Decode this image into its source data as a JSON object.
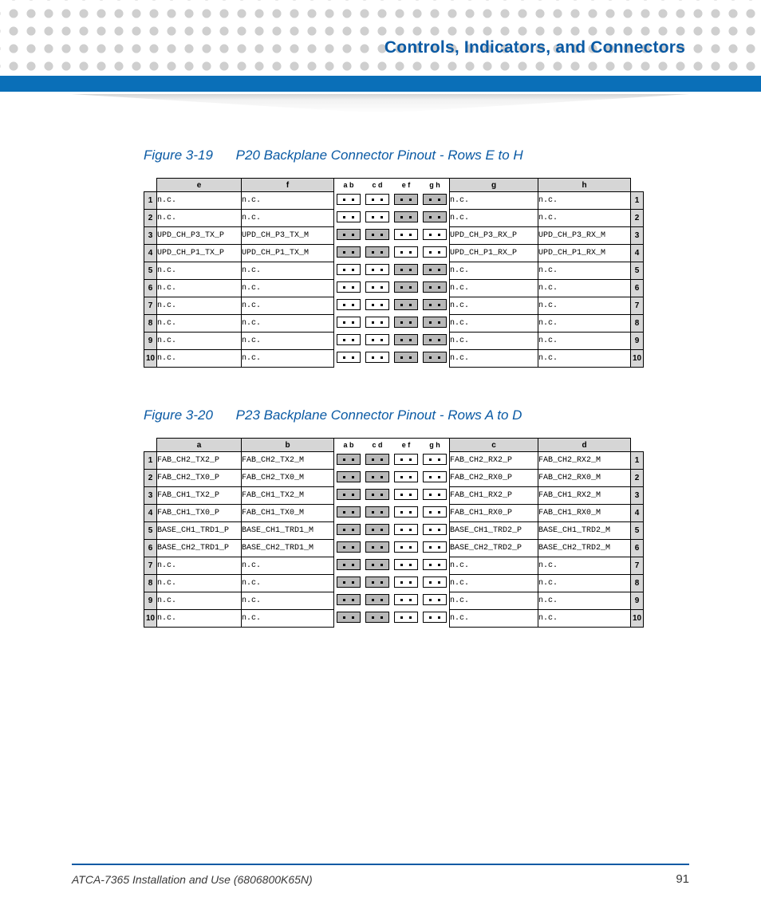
{
  "header": {
    "title": "Controls, Indicators, and Connectors"
  },
  "figures": [
    {
      "num": "Figure 3-19",
      "title": "P20 Backplane Connector Pinout - Rows E to H",
      "left_cols": [
        "e",
        "f"
      ],
      "right_cols": [
        "g",
        "h"
      ],
      "pair_headers": [
        "a b",
        "c d",
        "e f",
        "g h"
      ],
      "rows": [
        {
          "n": "1",
          "e": "n.c.",
          "f": "n.c.",
          "g": "n.c.",
          "h": "n.c.",
          "shade": [
            0,
            0,
            1,
            1
          ]
        },
        {
          "n": "2",
          "e": "n.c.",
          "f": "n.c.",
          "g": "n.c.",
          "h": "n.c.",
          "shade": [
            0,
            0,
            1,
            1
          ]
        },
        {
          "n": "3",
          "e": "UPD_CH_P3_TX_P",
          "f": "UPD_CH_P3_TX_M",
          "g": "UPD_CH_P3_RX_P",
          "h": "UPD_CH_P3_RX_M",
          "shade": [
            1,
            1,
            0,
            0
          ]
        },
        {
          "n": "4",
          "e": "UPD_CH_P1_TX_P",
          "f": "UPD_CH_P1_TX_M",
          "g": "UPD_CH_P1_RX_P",
          "h": "UPD_CH_P1_RX_M",
          "shade": [
            1,
            1,
            0,
            0
          ]
        },
        {
          "n": "5",
          "e": "n.c.",
          "f": "n.c.",
          "g": "n.c.",
          "h": "n.c.",
          "shade": [
            0,
            0,
            1,
            1
          ]
        },
        {
          "n": "6",
          "e": "n.c.",
          "f": "n.c.",
          "g": "n.c.",
          "h": "n.c.",
          "shade": [
            0,
            0,
            1,
            1
          ]
        },
        {
          "n": "7",
          "e": "n.c.",
          "f": "n.c.",
          "g": "n.c.",
          "h": "n.c.",
          "shade": [
            0,
            0,
            1,
            1
          ]
        },
        {
          "n": "8",
          "e": "n.c.",
          "f": "n.c.",
          "g": "n.c.",
          "h": "n.c.",
          "shade": [
            0,
            0,
            1,
            1
          ]
        },
        {
          "n": "9",
          "e": "n.c.",
          "f": "n.c.",
          "g": "n.c.",
          "h": "n.c.",
          "shade": [
            0,
            0,
            1,
            1
          ]
        },
        {
          "n": "10",
          "e": "n.c.",
          "f": "n.c.",
          "g": "n.c.",
          "h": "n.c.",
          "shade": [
            0,
            0,
            1,
            1
          ]
        }
      ]
    },
    {
      "num": "Figure 3-20",
      "title": "P23 Backplane Connector Pinout - Rows A to D",
      "left_cols": [
        "a",
        "b"
      ],
      "right_cols": [
        "c",
        "d"
      ],
      "pair_headers": [
        "a b",
        "c d",
        "e f",
        "g h"
      ],
      "rows": [
        {
          "n": "1",
          "a": "FAB_CH2_TX2_P",
          "b": "FAB_CH2_TX2_M",
          "c": "FAB_CH2_RX2_P",
          "d": "FAB_CH2_RX2_M",
          "shade": [
            1,
            1,
            0,
            0
          ]
        },
        {
          "n": "2",
          "a": "FAB_CH2_TX0_P",
          "b": "FAB_CH2_TX0_M",
          "c": "FAB_CH2_RX0_P",
          "d": "FAB_CH2_RX0_M",
          "shade": [
            1,
            1,
            0,
            0
          ]
        },
        {
          "n": "3",
          "a": "FAB_CH1_TX2_P",
          "b": "FAB_CH1_TX2_M",
          "c": "FAB_CH1_RX2_P",
          "d": "FAB_CH1_RX2_M",
          "shade": [
            1,
            1,
            0,
            0
          ]
        },
        {
          "n": "4",
          "a": "FAB_CH1_TX0_P",
          "b": "FAB_CH1_TX0_M",
          "c": "FAB_CH1_RX0_P",
          "d": "FAB_CH1_RX0_M",
          "shade": [
            1,
            1,
            0,
            0
          ]
        },
        {
          "n": "5",
          "a": "BASE_CH1_TRD1_P",
          "b": "BASE_CH1_TRD1_M",
          "c": "BASE_CH1_TRD2_P",
          "d": "BASE_CH1_TRD2_M",
          "shade": [
            1,
            1,
            0,
            0
          ]
        },
        {
          "n": "6",
          "a": "BASE_CH2_TRD1_P",
          "b": "BASE_CH2_TRD1_M",
          "c": "BASE_CH2_TRD2_P",
          "d": "BASE_CH2_TRD2_M",
          "shade": [
            1,
            1,
            0,
            0
          ]
        },
        {
          "n": "7",
          "a": "n.c.",
          "b": "n.c.",
          "c": "n.c.",
          "d": "n.c.",
          "shade": [
            1,
            1,
            0,
            0
          ]
        },
        {
          "n": "8",
          "a": "n.c.",
          "b": "n.c.",
          "c": "n.c.",
          "d": "n.c.",
          "shade": [
            1,
            1,
            0,
            0
          ]
        },
        {
          "n": "9",
          "a": "n.c.",
          "b": "n.c.",
          "c": "n.c.",
          "d": "n.c.",
          "shade": [
            1,
            1,
            0,
            0
          ]
        },
        {
          "n": "10",
          "a": "n.c.",
          "b": "n.c.",
          "c": "n.c.",
          "d": "n.c.",
          "shade": [
            1,
            1,
            0,
            0
          ]
        }
      ]
    }
  ],
  "footer": {
    "doc": "ATCA-7365 Installation and Use (6806800K65N)",
    "page": "91"
  }
}
